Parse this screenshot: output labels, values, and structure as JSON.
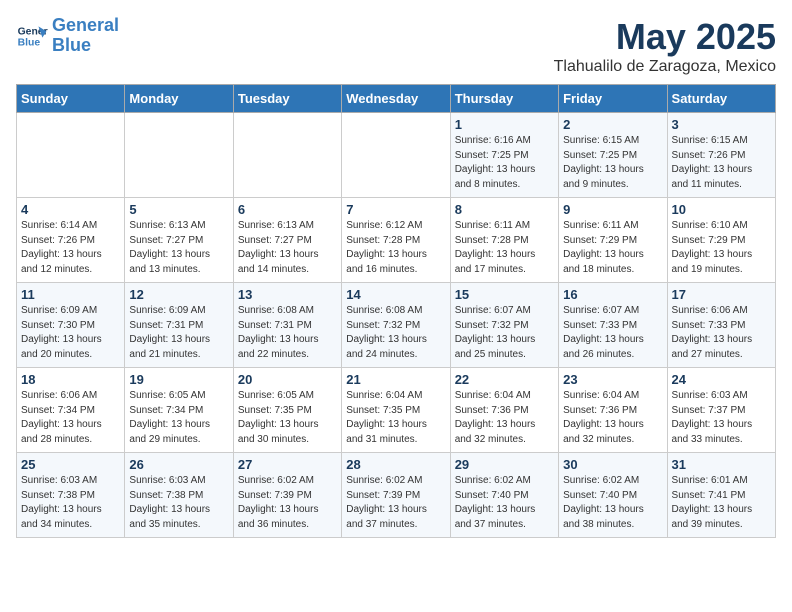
{
  "header": {
    "logo_line1": "General",
    "logo_line2": "Blue",
    "month": "May 2025",
    "location": "Tlahualilo de Zaragoza, Mexico"
  },
  "weekdays": [
    "Sunday",
    "Monday",
    "Tuesday",
    "Wednesday",
    "Thursday",
    "Friday",
    "Saturday"
  ],
  "weeks": [
    [
      {
        "day": "",
        "info": ""
      },
      {
        "day": "",
        "info": ""
      },
      {
        "day": "",
        "info": ""
      },
      {
        "day": "",
        "info": ""
      },
      {
        "day": "1",
        "info": "Sunrise: 6:16 AM\nSunset: 7:25 PM\nDaylight: 13 hours\nand 8 minutes."
      },
      {
        "day": "2",
        "info": "Sunrise: 6:15 AM\nSunset: 7:25 PM\nDaylight: 13 hours\nand 9 minutes."
      },
      {
        "day": "3",
        "info": "Sunrise: 6:15 AM\nSunset: 7:26 PM\nDaylight: 13 hours\nand 11 minutes."
      }
    ],
    [
      {
        "day": "4",
        "info": "Sunrise: 6:14 AM\nSunset: 7:26 PM\nDaylight: 13 hours\nand 12 minutes."
      },
      {
        "day": "5",
        "info": "Sunrise: 6:13 AM\nSunset: 7:27 PM\nDaylight: 13 hours\nand 13 minutes."
      },
      {
        "day": "6",
        "info": "Sunrise: 6:13 AM\nSunset: 7:27 PM\nDaylight: 13 hours\nand 14 minutes."
      },
      {
        "day": "7",
        "info": "Sunrise: 6:12 AM\nSunset: 7:28 PM\nDaylight: 13 hours\nand 16 minutes."
      },
      {
        "day": "8",
        "info": "Sunrise: 6:11 AM\nSunset: 7:28 PM\nDaylight: 13 hours\nand 17 minutes."
      },
      {
        "day": "9",
        "info": "Sunrise: 6:11 AM\nSunset: 7:29 PM\nDaylight: 13 hours\nand 18 minutes."
      },
      {
        "day": "10",
        "info": "Sunrise: 6:10 AM\nSunset: 7:29 PM\nDaylight: 13 hours\nand 19 minutes."
      }
    ],
    [
      {
        "day": "11",
        "info": "Sunrise: 6:09 AM\nSunset: 7:30 PM\nDaylight: 13 hours\nand 20 minutes."
      },
      {
        "day": "12",
        "info": "Sunrise: 6:09 AM\nSunset: 7:31 PM\nDaylight: 13 hours\nand 21 minutes."
      },
      {
        "day": "13",
        "info": "Sunrise: 6:08 AM\nSunset: 7:31 PM\nDaylight: 13 hours\nand 22 minutes."
      },
      {
        "day": "14",
        "info": "Sunrise: 6:08 AM\nSunset: 7:32 PM\nDaylight: 13 hours\nand 24 minutes."
      },
      {
        "day": "15",
        "info": "Sunrise: 6:07 AM\nSunset: 7:32 PM\nDaylight: 13 hours\nand 25 minutes."
      },
      {
        "day": "16",
        "info": "Sunrise: 6:07 AM\nSunset: 7:33 PM\nDaylight: 13 hours\nand 26 minutes."
      },
      {
        "day": "17",
        "info": "Sunrise: 6:06 AM\nSunset: 7:33 PM\nDaylight: 13 hours\nand 27 minutes."
      }
    ],
    [
      {
        "day": "18",
        "info": "Sunrise: 6:06 AM\nSunset: 7:34 PM\nDaylight: 13 hours\nand 28 minutes."
      },
      {
        "day": "19",
        "info": "Sunrise: 6:05 AM\nSunset: 7:34 PM\nDaylight: 13 hours\nand 29 minutes."
      },
      {
        "day": "20",
        "info": "Sunrise: 6:05 AM\nSunset: 7:35 PM\nDaylight: 13 hours\nand 30 minutes."
      },
      {
        "day": "21",
        "info": "Sunrise: 6:04 AM\nSunset: 7:35 PM\nDaylight: 13 hours\nand 31 minutes."
      },
      {
        "day": "22",
        "info": "Sunrise: 6:04 AM\nSunset: 7:36 PM\nDaylight: 13 hours\nand 32 minutes."
      },
      {
        "day": "23",
        "info": "Sunrise: 6:04 AM\nSunset: 7:36 PM\nDaylight: 13 hours\nand 32 minutes."
      },
      {
        "day": "24",
        "info": "Sunrise: 6:03 AM\nSunset: 7:37 PM\nDaylight: 13 hours\nand 33 minutes."
      }
    ],
    [
      {
        "day": "25",
        "info": "Sunrise: 6:03 AM\nSunset: 7:38 PM\nDaylight: 13 hours\nand 34 minutes."
      },
      {
        "day": "26",
        "info": "Sunrise: 6:03 AM\nSunset: 7:38 PM\nDaylight: 13 hours\nand 35 minutes."
      },
      {
        "day": "27",
        "info": "Sunrise: 6:02 AM\nSunset: 7:39 PM\nDaylight: 13 hours\nand 36 minutes."
      },
      {
        "day": "28",
        "info": "Sunrise: 6:02 AM\nSunset: 7:39 PM\nDaylight: 13 hours\nand 37 minutes."
      },
      {
        "day": "29",
        "info": "Sunrise: 6:02 AM\nSunset: 7:40 PM\nDaylight: 13 hours\nand 37 minutes."
      },
      {
        "day": "30",
        "info": "Sunrise: 6:02 AM\nSunset: 7:40 PM\nDaylight: 13 hours\nand 38 minutes."
      },
      {
        "day": "31",
        "info": "Sunrise: 6:01 AM\nSunset: 7:41 PM\nDaylight: 13 hours\nand 39 minutes."
      }
    ]
  ]
}
